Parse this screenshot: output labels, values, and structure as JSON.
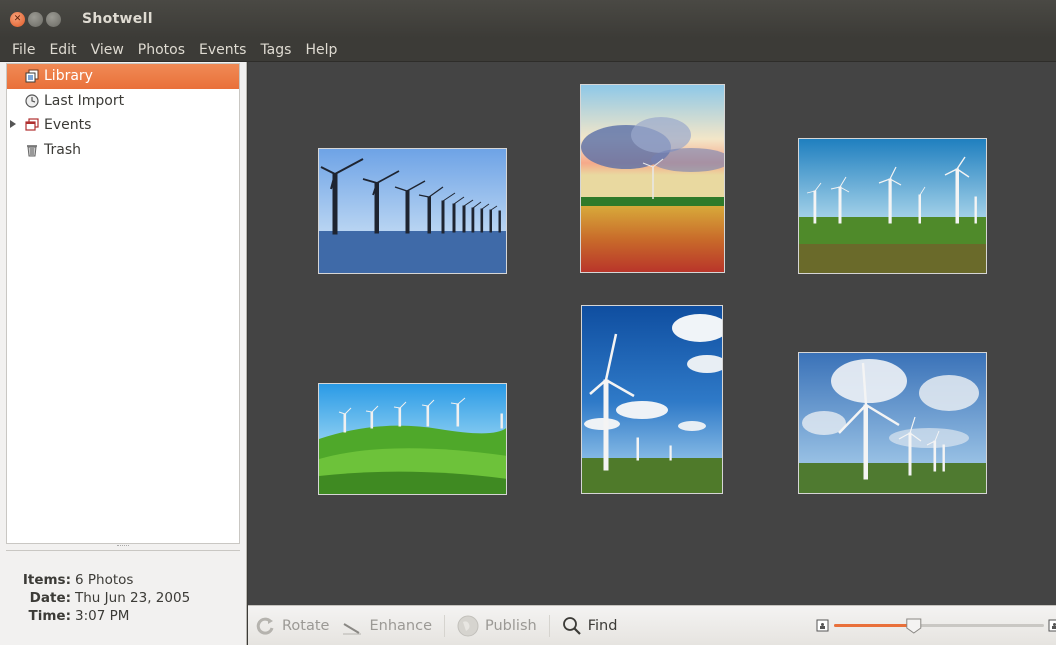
{
  "window": {
    "title": "Shotwell"
  },
  "menu": [
    "File",
    "Edit",
    "View",
    "Photos",
    "Events",
    "Tags",
    "Help"
  ],
  "sidebar": {
    "items": [
      {
        "label": "Library",
        "icon": "library-icon",
        "selected": true
      },
      {
        "label": "Last Import",
        "icon": "clock-icon",
        "selected": false
      },
      {
        "label": "Events",
        "icon": "events-icon",
        "selected": false,
        "expandable": true
      },
      {
        "label": "Trash",
        "icon": "trash-icon",
        "selected": false
      }
    ]
  },
  "info": {
    "items_label": "Items:",
    "items_value": "6 Photos",
    "date_label": "Date:",
    "date_value": "Thu Jun 23, 2005",
    "time_label": "Time:",
    "time_value": "3:07 PM"
  },
  "photos": [
    {
      "subject": "offshore wind turbines"
    },
    {
      "subject": "wind turbine at sunset over field"
    },
    {
      "subject": "wind farm on grassland"
    },
    {
      "subject": "wind turbines on green hills"
    },
    {
      "subject": "wind turbine against blue sky"
    },
    {
      "subject": "wind turbines under cloudy sky"
    }
  ],
  "toolbar": {
    "rotate_label": "Rotate",
    "enhance_label": "Enhance",
    "publish_label": "Publish",
    "find_label": "Find",
    "zoom_level": 0.38
  },
  "colors": {
    "accent": "#e9703a",
    "titlebar": "#3c3b37",
    "photo_bg": "#444444"
  }
}
